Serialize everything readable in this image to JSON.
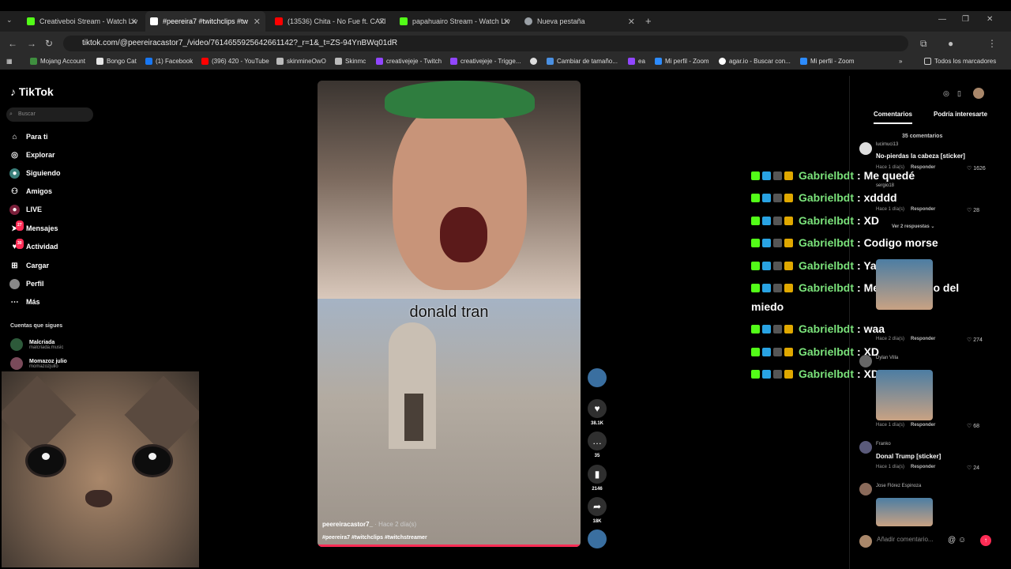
{
  "browser": {
    "tabs": [
      {
        "label": "Creativeboi Stream - Watch Liv",
        "color": "#53fc18"
      },
      {
        "label": "#peereira7 #twitchclips #tw",
        "color": "#ffffff"
      },
      {
        "label": "(13536) Chita - No Fue ft. CA7I",
        "color": "#ff0000"
      },
      {
        "label": "papahuairo Stream - Watch Liv",
        "color": "#53fc18"
      },
      {
        "label": "Nueva pestaña",
        "color": "#9aa0a6"
      }
    ],
    "url": "tiktok.com/@peereiracastor7_/video/7614655925642661142?_r=1&_t=ZS-94YnBWq01dR",
    "bookmarks": [
      {
        "label": "Mojang Account",
        "color": "#3f8f3f"
      },
      {
        "label": "Bongo Cat",
        "color": "#e6e6e6"
      },
      {
        "label": "(1) Facebook",
        "color": "#1877f2"
      },
      {
        "label": "(396) 420 - YouTube",
        "color": "#ff0000"
      },
      {
        "label": "skinmineOwO",
        "color": "#bbbbbb"
      },
      {
        "label": "Skinmc",
        "color": "#bbbbbb"
      },
      {
        "label": "creativejeje - Twitch",
        "color": "#9146ff"
      },
      {
        "label": "creativejeje - Trigge...",
        "color": "#9146ff"
      },
      {
        "label": "",
        "color": "#dddddd"
      },
      {
        "label": "Cambiar de tamaño...",
        "color": "#4a90e2"
      },
      {
        "label": "ea",
        "color": "#9146ff"
      },
      {
        "label": "Mi perfil - Zoom",
        "color": "#2d8cff"
      },
      {
        "label": "agar.io - Buscar con...",
        "color": "#ffffff"
      },
      {
        "label": "Mi perfil - Zoom",
        "color": "#2d8cff"
      }
    ],
    "all_bookmarks": "Todos los marcadores"
  },
  "tiktok": {
    "logo": "TikTok",
    "search_placeholder": "Buscar",
    "nav": [
      {
        "label": "Para ti",
        "icon": "home-icon"
      },
      {
        "label": "Explorar",
        "icon": "compass-icon"
      },
      {
        "label": "Siguiendo",
        "icon": "following-icon"
      },
      {
        "label": "Amigos",
        "icon": "friends-icon"
      },
      {
        "label": "LIVE",
        "icon": "live-icon"
      },
      {
        "label": "Mensajes",
        "icon": "message-icon",
        "badge": "27"
      },
      {
        "label": "Actividad",
        "icon": "activity-icon",
        "badge": "30"
      },
      {
        "label": "Cargar",
        "icon": "upload-icon"
      },
      {
        "label": "Perfil",
        "icon": "profile-icon"
      },
      {
        "label": "Más",
        "icon": "more-icon"
      }
    ],
    "follows_title": "Cuentas que sigues",
    "follows": [
      {
        "name": "Malcriada",
        "handle": "malcriada.music"
      },
      {
        "name": "Momazoz julio",
        "handle": "momazozjulio"
      }
    ]
  },
  "video": {
    "caption": "donald tran",
    "author": "peereiracastor7_",
    "posted": "· Hace 2 día(s)",
    "tags": "#peereira7 #twitchclips #twitchstreamer"
  },
  "actions": {
    "likes": "38.1K",
    "comments": "35",
    "saves": "2146",
    "shares": "18K"
  },
  "chat": [
    {
      "user": "Gabrielbdt",
      "msg": ": Me quedé"
    },
    {
      "user": "Gabrielbdt",
      "msg": ": xdddd"
    },
    {
      "user": "Gabrielbdt",
      "msg": ": XD"
    },
    {
      "user": "Gabrielbdt",
      "msg": ": Codigo morse"
    },
    {
      "user": "Gabrielbdt",
      "msg": ": Ya fue"
    },
    {
      "user": "Gabrielbdt",
      "msg": ": Me cague y no del"
    },
    {
      "user": "Gabrielbdt",
      "msg": ": waa"
    },
    {
      "user": "Gabrielbdt",
      "msg": ": XD"
    },
    {
      "user": "Gabrielbdt",
      "msg": ": XD"
    }
  ],
  "chat_wrap": "miedo",
  "comments": {
    "tab_comments": "Comentarios",
    "tab_interesting": "Podría interesarte",
    "count": "35 comentarios",
    "items": [
      {
        "user": "lucimuci13",
        "text": "No-pierdas la cabeza [sticker]",
        "meta": "Hace 1 día(s)",
        "likes": "1626"
      },
      {
        "user": "sergio18",
        "text": "",
        "meta": "Hace 1 día(s)",
        "likes": "28"
      },
      {
        "user": "",
        "text": "",
        "meta": "Hace 2 día(s)",
        "likes": "274"
      },
      {
        "user": "Dylan Villa",
        "text": "",
        "meta": "Hace 1 día(s)",
        "likes": "68"
      },
      {
        "user": "Franko",
        "text": "Donal Trump [sticker]",
        "meta": "Hace 1 día(s)",
        "likes": "24"
      },
      {
        "user": "Jose Flórez Espinoza",
        "text": "",
        "meta": "",
        "likes": ""
      }
    ],
    "view_replies": "Ver 2 respuestas",
    "reply_label": "Responder",
    "input_placeholder": "Añadir comentario..."
  }
}
